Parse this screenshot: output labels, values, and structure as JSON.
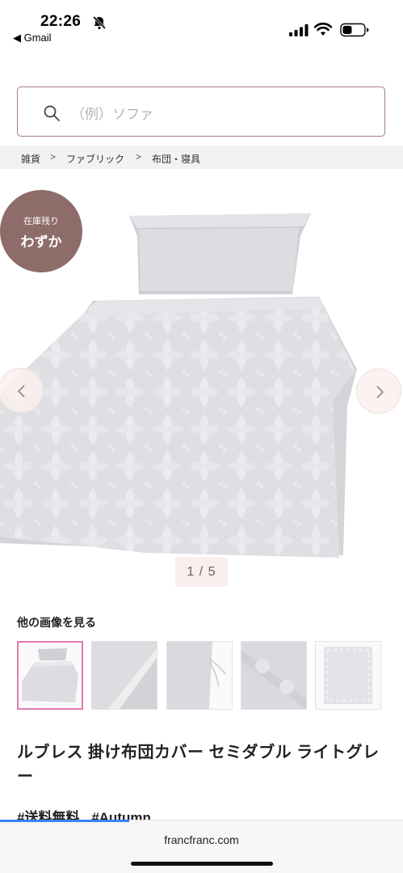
{
  "status_bar": {
    "time": "22:26",
    "back_app": "◀ Gmail",
    "icons": [
      "bell-off-icon",
      "signal-icon",
      "wifi-icon",
      "battery-icon"
    ]
  },
  "search": {
    "placeholder": "（例）ソファ",
    "border_color": "#a57f79"
  },
  "breadcrumb": {
    "items": [
      "雑貨",
      "ファブリック",
      "布団・寝具"
    ],
    "separator": ">"
  },
  "product_gallery": {
    "stock_badge": {
      "line1": "在庫残り",
      "line2": "わずか",
      "color": "#8e6c6a"
    },
    "pager": "1 / 5",
    "more_images_label": "他の画像を見る",
    "thumbnail_count": 5,
    "selected_thumbnail": 1
  },
  "product": {
    "title": "ルブレス 掛け布団カバー セミダブル ライトグレー",
    "tags": [
      "#送料無料",
      "#Autumn"
    ]
  },
  "browser": {
    "url": "francfranc.com",
    "progress_fraction": 0.32
  }
}
